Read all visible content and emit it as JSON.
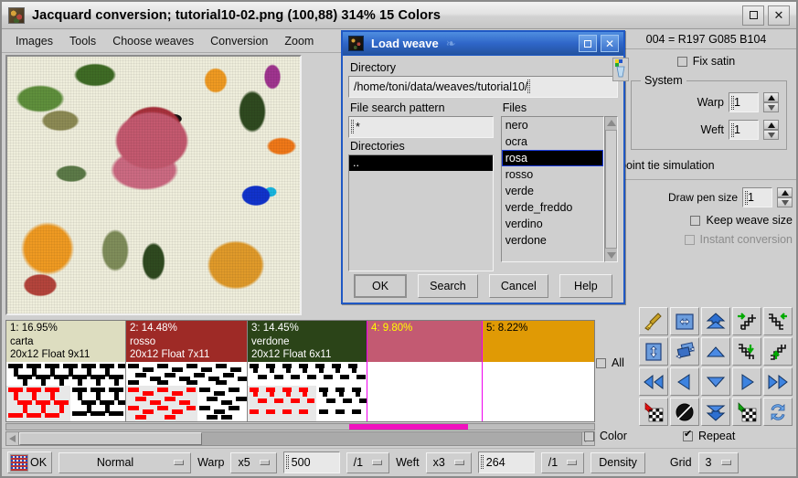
{
  "window": {
    "title": "Jacquard conversion; tutorial10-02.png (100,88) 314% 15 Colors",
    "maximize_label": "□",
    "close_label": "✕"
  },
  "menubar": {
    "items": [
      {
        "label": "Images"
      },
      {
        "label": "Tools"
      },
      {
        "label": "Choose weaves"
      },
      {
        "label": "Conversion"
      },
      {
        "label": "Zoom"
      }
    ]
  },
  "right_panel": {
    "rgb_readout": "004 = R197 G085 B104",
    "fix_satin": {
      "label": "Fix satin",
      "checked": false
    },
    "system_group": {
      "label": "System",
      "warp": {
        "label": "Warp",
        "value": "1"
      },
      "weft": {
        "label": "Weft",
        "value": "1"
      }
    },
    "point_tie_simulation": "point tie simulation",
    "draw_pen_size": {
      "label": "Draw pen size",
      "value": "1"
    },
    "keep_weave_size": {
      "label": "Keep weave size",
      "checked": false
    },
    "instant_conversion": {
      "label": "Instant conversion",
      "checked": false,
      "disabled": true
    }
  },
  "tool_grid": {
    "icons": [
      "broom-icon",
      "flip-horizontal-icon",
      "arrow-up-double-icon",
      "stairs-right-icon",
      "stairs-left-icon",
      "flip-vertical-icon",
      "layers-copy-icon",
      "arrow-up-single-icon",
      "stairs-down-icon",
      "stairs-up-icon",
      "rewind-icon",
      "arrow-left-icon",
      "arrow-down-single-icon",
      "arrow-right-icon",
      "fast-forward-icon",
      "checker-insert-icon",
      "invert-icon",
      "arrow-down-double-icon",
      "checker-extract-icon",
      "refresh-icon"
    ]
  },
  "checkboxes": {
    "all": {
      "label": "All",
      "checked": false
    },
    "color": {
      "label": "Color",
      "checked": false
    },
    "repeat": {
      "label": "Repeat",
      "checked": true
    }
  },
  "palette": {
    "entries": [
      {
        "index": "1: 16.95%",
        "name": "carta",
        "spec": "20x12 Float 9x11",
        "color": "#ddddc0",
        "text_color": "#000000",
        "has_weave": true,
        "border": "#888888"
      },
      {
        "index": "2: 14.48%",
        "name": "rosso",
        "spec": "20x12 Float 7x11",
        "color": "#9e2a26",
        "text_color": "#ffffff",
        "has_weave": true,
        "border": "#888888"
      },
      {
        "index": "3: 14.45%",
        "name": "verdone",
        "spec": "20x12 Float 6x11",
        "color": "#2b4418",
        "text_color": "#ffffff",
        "has_weave": true,
        "border": "#888888"
      },
      {
        "index": "4: 9.80%",
        "name": "",
        "spec": "",
        "color": "#c35a72",
        "text_color": "#ffff00",
        "has_weave": false,
        "border": "#ee00ee"
      },
      {
        "index": "5: 8.22%",
        "name": "",
        "spec": "",
        "color": "#e09a05",
        "text_color": "#000000",
        "has_weave": false,
        "border": "#888888"
      }
    ]
  },
  "bottom_bar": {
    "ok_label": "OK",
    "mode": "Normal",
    "warp_label": "Warp",
    "warp_mult": "x5",
    "warp_value": "500",
    "warp_div": "/1",
    "weft_label": "Weft",
    "weft_mult": "x3",
    "weft_value": "264",
    "weft_div": "/1",
    "density_label": "Density",
    "grid_label": "Grid",
    "grid_value": "3"
  },
  "dialog": {
    "title": "Load weave",
    "maximize_label": "□",
    "close_label": "✕",
    "directory_label": "Directory",
    "directory_value": "/home/toni/data/weaves/tutorial10/",
    "pattern_label": "File search pattern",
    "pattern_value": "*",
    "directories_label": "Directories",
    "directories": [
      ".."
    ],
    "files_label": "Files",
    "files": [
      {
        "name": "nero",
        "selected": false
      },
      {
        "name": "ocra",
        "selected": false
      },
      {
        "name": "rosa",
        "selected": true
      },
      {
        "name": "rosso",
        "selected": false
      },
      {
        "name": "verde",
        "selected": false
      },
      {
        "name": "verde_freddo",
        "selected": false
      },
      {
        "name": "verdino",
        "selected": false
      },
      {
        "name": "verdone",
        "selected": false
      }
    ],
    "buttons": {
      "ok": "OK",
      "search": "Search",
      "cancel": "Cancel",
      "help": "Help"
    }
  }
}
